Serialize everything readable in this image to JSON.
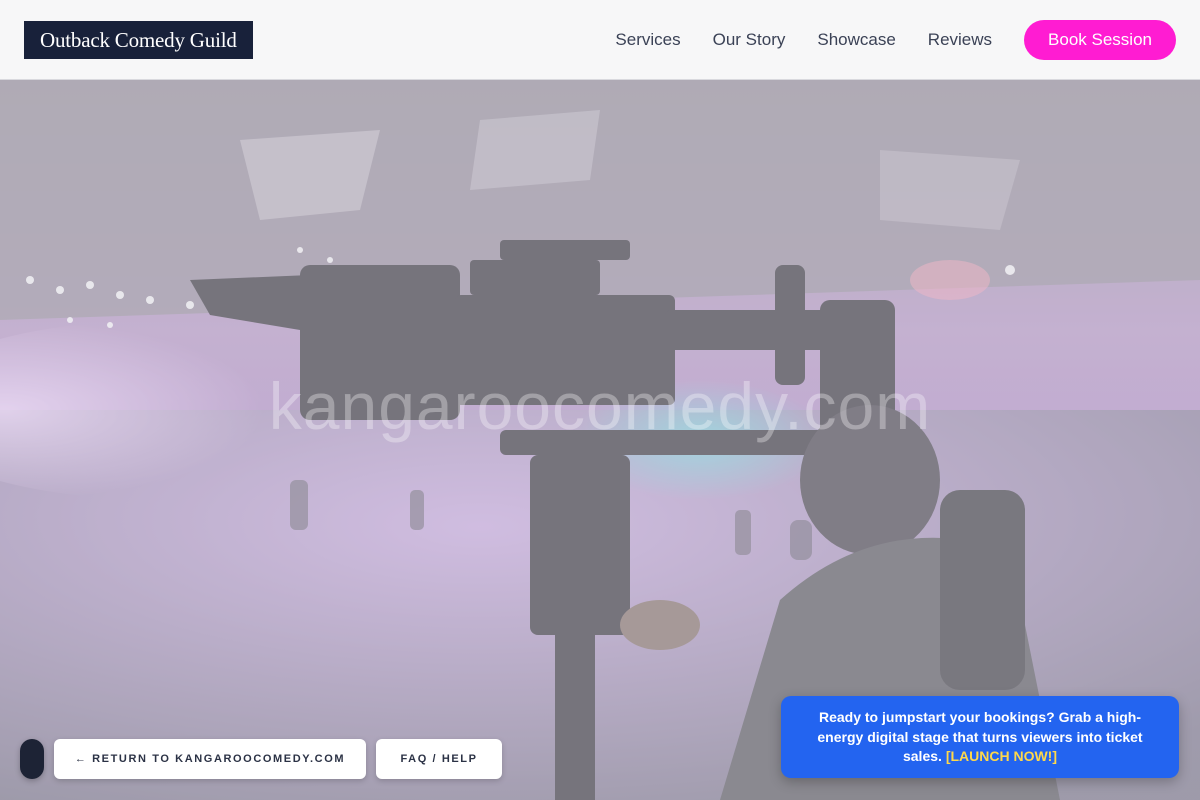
{
  "header": {
    "logo_text": "Outback Comedy Guild",
    "nav": [
      {
        "label": "Services"
      },
      {
        "label": "Our Story"
      },
      {
        "label": "Showcase"
      },
      {
        "label": "Reviews"
      }
    ],
    "cta_label": "Book Session"
  },
  "hero": {
    "watermark_text": "kangaroocomedy.com",
    "image_icon": "camera-operator-photo"
  },
  "footer_controls": {
    "return_label": "← RETURN TO KANGAROOCOMEDY.COM",
    "faq_label": "FAQ / HELP"
  },
  "promo": {
    "text": "Ready to jumpstart your bookings? Grab a high-energy digital stage that turns viewers into ticket sales.",
    "link_label": "[LAUNCH NOW!]"
  },
  "colors": {
    "logo_bg": "#18213a",
    "accent_pink": "#ff1cd2",
    "promo_blue": "#2364f0",
    "promo_link": "#ffd84a"
  }
}
